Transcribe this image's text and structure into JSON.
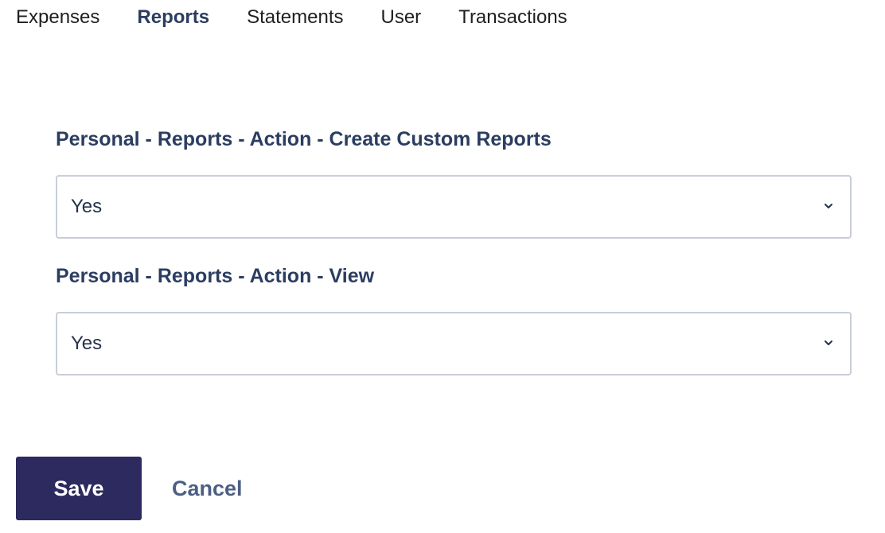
{
  "tabs": [
    {
      "label": "Expenses",
      "active": false
    },
    {
      "label": "Reports",
      "active": true
    },
    {
      "label": "Statements",
      "active": false
    },
    {
      "label": "User",
      "active": false
    },
    {
      "label": "Transactions",
      "active": false
    }
  ],
  "fields": [
    {
      "label": "Personal - Reports - Action - Create Custom Reports",
      "value": "Yes",
      "icon": "chevron-down-icon"
    },
    {
      "label": "Personal - Reports - Action - View",
      "value": "Yes",
      "icon": "chevron-down-icon"
    }
  ],
  "actions": {
    "save_label": "Save",
    "cancel_label": "Cancel"
  },
  "colors": {
    "accent": "#2c2a5f",
    "label": "#2b3d61",
    "cancel": "#4d5f82",
    "border": "#c9ced6"
  }
}
